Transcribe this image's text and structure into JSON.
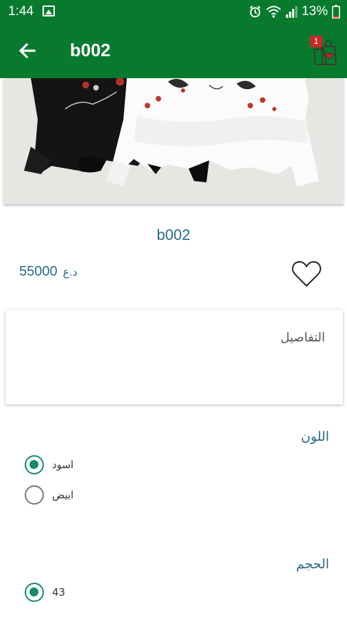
{
  "status_bar": {
    "time": "1:44",
    "battery": "13%"
  },
  "app_bar": {
    "title": "b002",
    "cart_count": "1"
  },
  "product": {
    "name": "b002",
    "price": "55000",
    "currency": "د.ع"
  },
  "details": {
    "label": "التفاصيل"
  },
  "color_section": {
    "title": "اللون",
    "options": [
      {
        "label": "اسود",
        "selected": true
      },
      {
        "label": "ابيض",
        "selected": false
      }
    ]
  },
  "size_section": {
    "title": "الحجم",
    "options": [
      {
        "label": "43",
        "selected": true
      }
    ]
  },
  "colors": {
    "primary": "#087a2e",
    "accent": "#138a6c",
    "text_accent": "#256b8c",
    "badge": "#c62828"
  }
}
